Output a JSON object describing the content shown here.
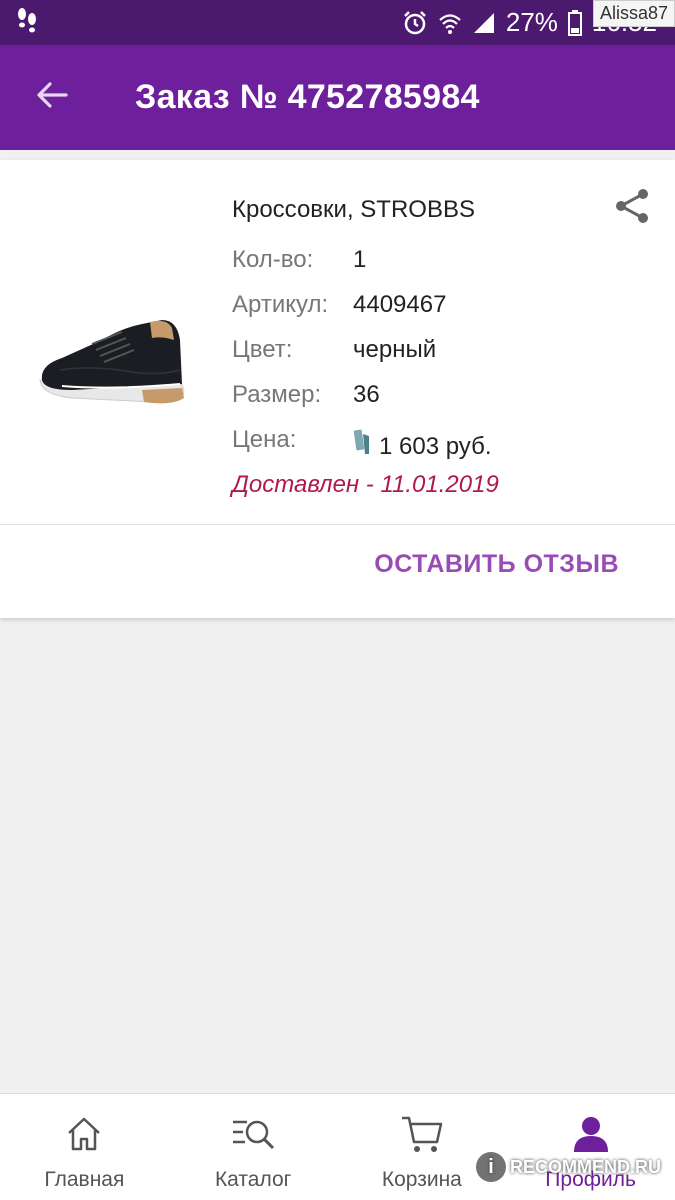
{
  "status_bar": {
    "battery": "27%",
    "time": "16:52",
    "user_watermark": "Alissa87"
  },
  "app_bar": {
    "title": "Заказ № 4752785984"
  },
  "order_item": {
    "name": "Кроссовки, STROBBS",
    "fields": [
      {
        "label": "Кол-во:",
        "value": "1"
      },
      {
        "label": "Артикул:",
        "value": "4409467"
      },
      {
        "label": "Цвет:",
        "value": "черный"
      },
      {
        "label": "Размер:",
        "value": "36"
      }
    ],
    "price_label": "Цена:",
    "price_value": "1 603 руб.",
    "status": "Доставлен - 11.01.2019",
    "review_button": "ОСТАВИТЬ ОТЗЫВ"
  },
  "bottom_nav": {
    "items": [
      {
        "label": "Главная",
        "icon": "home-icon"
      },
      {
        "label": "Каталог",
        "icon": "catalog-search-icon"
      },
      {
        "label": "Корзина",
        "icon": "cart-icon"
      },
      {
        "label": "Профиль",
        "icon": "profile-icon"
      }
    ]
  },
  "watermark": "RECOMMEND.RU",
  "colors": {
    "app_bar": "#6d1f9c",
    "status_bar": "#4b1a6e",
    "accent": "#9b4bb5",
    "delivered": "#b0194a"
  }
}
